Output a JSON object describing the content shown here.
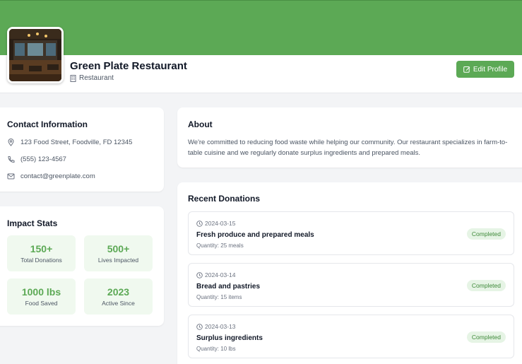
{
  "profile": {
    "name": "Green Plate Restaurant",
    "type": "Restaurant",
    "edit_label": "Edit Profile"
  },
  "contact": {
    "title": "Contact Information",
    "address": "123 Food Street, Foodville, FD 12345",
    "phone": "(555) 123-4567",
    "email": "contact@greenplate.com"
  },
  "impact": {
    "title": "Impact Stats",
    "stats": [
      {
        "value": "150+",
        "label": "Total Donations"
      },
      {
        "value": "500+",
        "label": "Lives Impacted"
      },
      {
        "value": "1000 lbs",
        "label": "Food Saved"
      },
      {
        "value": "2023",
        "label": "Active Since"
      }
    ]
  },
  "about": {
    "title": "About",
    "text": "We're committed to reducing food waste while helping our community. Our restaurant specializes in farm-to-table cuisine and we regularly donate surplus ingredients and prepared meals."
  },
  "donations": {
    "title": "Recent Donations",
    "items": [
      {
        "date": "2024-03-15",
        "title": "Fresh produce and prepared meals",
        "quantity": "Quantity: 25 meals",
        "status": "Completed"
      },
      {
        "date": "2024-03-14",
        "title": "Bread and pastries",
        "quantity": "Quantity: 15 items",
        "status": "Completed"
      },
      {
        "date": "2024-03-13",
        "title": "Surplus ingredients",
        "quantity": "Quantity: 10 lbs",
        "status": "Completed"
      }
    ]
  },
  "colors": {
    "brand_green": "#5ca955",
    "badge_bg": "#e6f4e5",
    "stat_bg": "#f0f9ef"
  },
  "icons": {
    "type": "building-icon",
    "edit": "edit-icon",
    "address": "map-pin-icon",
    "phone": "phone-icon",
    "email": "mail-icon",
    "date": "clock-icon"
  }
}
